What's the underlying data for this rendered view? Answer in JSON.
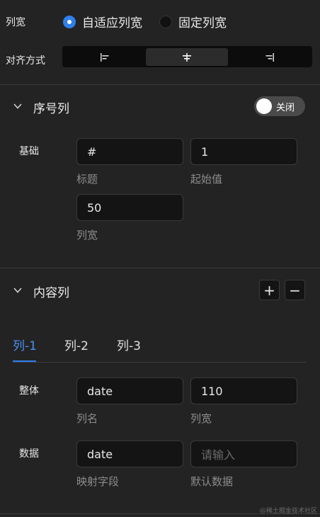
{
  "column_width": {
    "label": "列宽",
    "options": [
      {
        "label": "自适应列宽",
        "selected": true
      },
      {
        "label": "固定列宽",
        "selected": false
      }
    ]
  },
  "alignment": {
    "label": "对齐方式",
    "options": [
      {
        "icon": "align-left-icon",
        "glyph": "⊢",
        "active": false
      },
      {
        "icon": "align-center-icon",
        "glyph": "‡",
        "active": true
      },
      {
        "icon": "align-right-icon",
        "glyph": "⊣",
        "active": false
      }
    ]
  },
  "serial_column": {
    "title": "序号列",
    "toggle_label": "关闭",
    "row_label": "基础",
    "fields": [
      {
        "value": "#",
        "caption": "标题"
      },
      {
        "value": "1",
        "caption": "起始值"
      },
      {
        "value": "50",
        "caption": "列宽"
      }
    ]
  },
  "content_column": {
    "title": "内容列",
    "add_label": "+",
    "remove_label": "−",
    "tabs": [
      "列-1",
      "列-2",
      "列-3"
    ],
    "active_tab": 0,
    "overall": {
      "label": "整体",
      "fields": [
        {
          "value": "date",
          "caption": "列名"
        },
        {
          "value": "110",
          "caption": "列宽"
        }
      ]
    },
    "data": {
      "label": "数据",
      "fields": [
        {
          "value": "date",
          "caption": "映射字段"
        },
        {
          "value": "",
          "placeholder": "请输入",
          "caption": "默认数据"
        }
      ]
    }
  },
  "watermark": "@稀土掘金技术社区"
}
